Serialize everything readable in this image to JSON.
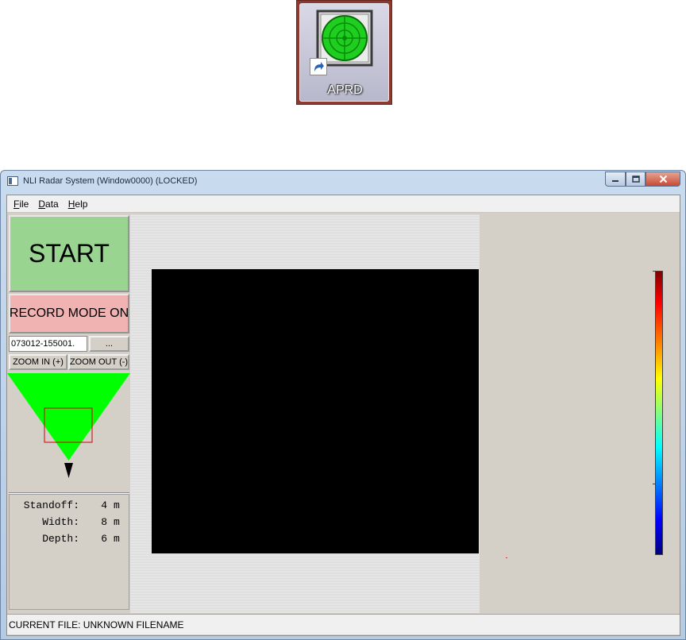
{
  "desktop": {
    "shortcut_label": "APRD",
    "icon": "radar-app-icon"
  },
  "window": {
    "title": "NLI Radar System (Window0000) (LOCKED)",
    "controls": {
      "minimize": "minimize-icon",
      "maximize": "maximize-icon",
      "close": "close-icon"
    }
  },
  "menu": {
    "items": [
      {
        "label": "File",
        "underline": "F",
        "rest": "ile"
      },
      {
        "label": "Data",
        "underline": "D",
        "rest": "ata"
      },
      {
        "label": "Help",
        "underline": "H",
        "rest": "elp"
      }
    ]
  },
  "controls": {
    "start_label": "START",
    "record_label": "RECORD MODE ON",
    "filename_value": "073012-155001.",
    "browse_label": "...",
    "zoom_in_label": "ZOOM IN (+)",
    "zoom_out_label": "ZOOM OUT (-)",
    "colors": {
      "start_bg": "#99d591",
      "record_bg": "#f1b2b2",
      "fov_fill": "#00ff00",
      "selection_box": "#cc0000"
    }
  },
  "params": {
    "standoff_label": "Standoff:",
    "standoff_value": "4",
    "standoff_unit": "m",
    "width_label": "Width:",
    "width_value": "8",
    "width_unit": "m",
    "depth_label": "Depth:",
    "depth_value": "6",
    "depth_unit": "m"
  },
  "status": {
    "current_file": "CURRENT FILE: UNKNOWN FILENAME"
  }
}
